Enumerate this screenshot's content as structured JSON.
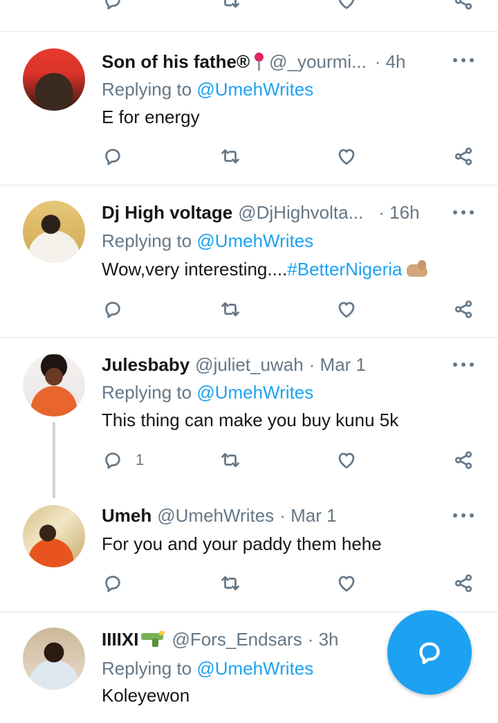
{
  "tweets": [
    {
      "name": "Son of his fathe®",
      "handle": "@_yourmi...",
      "time": "· 4h",
      "replying_prefix": "Replying to",
      "mention": "@UmehWrites",
      "text": "E for energy",
      "reply_count": ""
    },
    {
      "name": "Dj High voltage",
      "handle": "@DjHighvolta...",
      "time": "· 16h",
      "replying_prefix": "Replying to",
      "mention": "@UmehWrites",
      "text": "Wow,very interesting....",
      "hashtag": "#BetterNigeria",
      "reply_count": ""
    },
    {
      "name": "Julesbaby",
      "handle": "@juliet_uwah",
      "time": "· Mar 1",
      "replying_prefix": "Replying to",
      "mention": "@UmehWrites",
      "text": "This thing can make you buy kunu 5k",
      "reply_count": "1"
    },
    {
      "name": "Umeh",
      "handle": "@UmehWrites",
      "time": "· Mar 1",
      "text": "For you and your paddy them hehe",
      "reply_count": ""
    },
    {
      "name": "IIIIXI",
      "handle": "@Fors_Endsars",
      "time": "· 3h",
      "replying_prefix": "Replying to",
      "mention": "@UmehWrites",
      "text": "Koleyewon"
    }
  ],
  "icons": {
    "reply": "reply-icon",
    "retweet": "retweet-icon",
    "like": "heart-icon",
    "share": "share-icon",
    "more": "more-dots-icon",
    "compose": "compose-reply-icon"
  },
  "colors": {
    "accent": "#1da1f2",
    "muted": "#657786",
    "divider": "#e1e8ed"
  }
}
